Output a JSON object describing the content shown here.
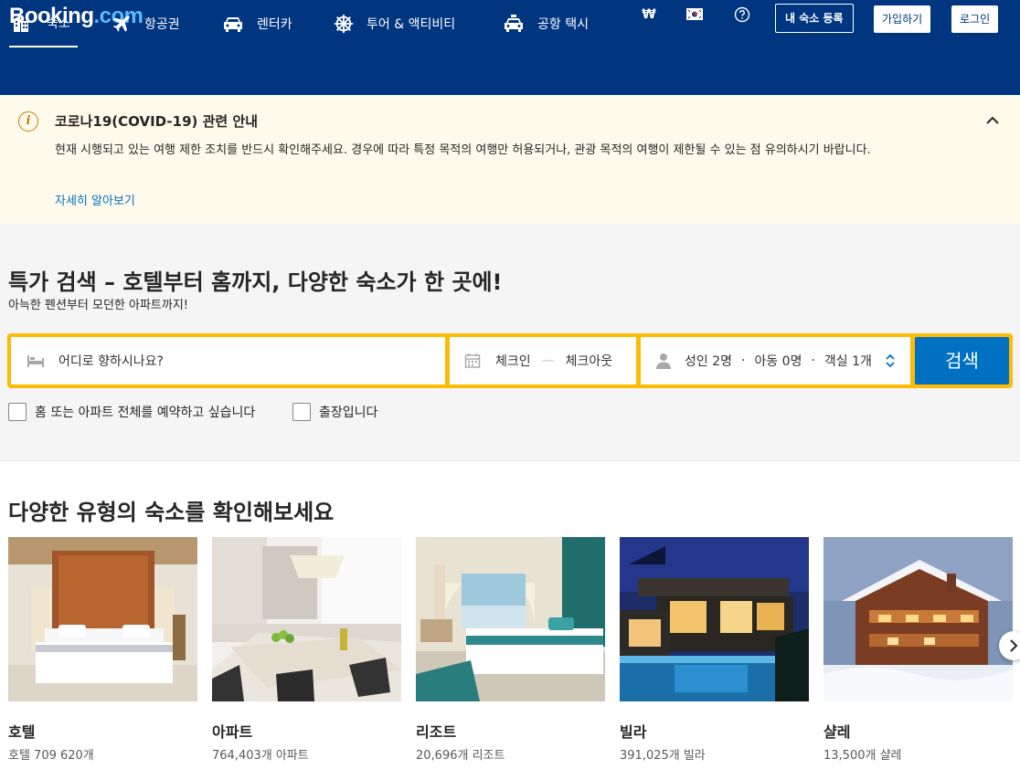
{
  "header": {
    "logo_main": "Booking",
    "logo_suffix": ".com",
    "currency": "₩",
    "list_property_label": "내 숙소 등록",
    "register_label": "가입하기",
    "login_label": "로그인"
  },
  "nav": {
    "items": [
      {
        "label": "숙소",
        "icon": "bed-icon"
      },
      {
        "label": "항공권",
        "icon": "plane-icon"
      },
      {
        "label": "렌터카",
        "icon": "car-icon"
      },
      {
        "label": "투어 & 액티비티",
        "icon": "attraction-icon"
      },
      {
        "label": "공항 택시",
        "icon": "taxi-icon"
      }
    ]
  },
  "notice": {
    "title": "코로나19(COVID-19) 관련 안내",
    "body": "현재 시행되고 있는 여행 제한 조치를 반드시 확인해주세요. 경우에 따라 특정 목적의 여행만 허용되거나, 관광 목적의 여행이 제한될 수 있는 점 유의하시기 바랍니다.",
    "link": "자세히 알아보기"
  },
  "search": {
    "title": "특가 검색 – 호텔부터 홈까지, 다양한 숙소가 한 곳에!",
    "subtitle": "아늑한 펜션부터 모던한 아파트까지!",
    "destination_placeholder": "어디로 향하시나요?",
    "checkin_label": "체크인",
    "date_separator": "—",
    "checkout_label": "체크아웃",
    "adults": "성인 2명",
    "sep": "·",
    "children": "아동 0명",
    "rooms": "객실 1개",
    "search_button": "검색",
    "checkbox_home": "홈 또는 아파트 전체를 예약하고 싶습니다",
    "checkbox_business": "출장입니다"
  },
  "property_types": {
    "title": "다양한 유형의 숙소를 확인해보세요",
    "cards": [
      {
        "name": "호텔",
        "count": "호텔 709 620개"
      },
      {
        "name": "아파트",
        "count": "764,403개 아파트"
      },
      {
        "name": "리조트",
        "count": "20,696개 리조트"
      },
      {
        "name": "빌라",
        "count": "391,025개 빌라"
      },
      {
        "name": "샬레",
        "count": "13,500개 샬레"
      }
    ]
  },
  "colors": {
    "brand_blue": "#003580",
    "accent_yellow": "#febb02",
    "button_blue": "#0071c2",
    "notice_bg": "#fffaeb"
  }
}
